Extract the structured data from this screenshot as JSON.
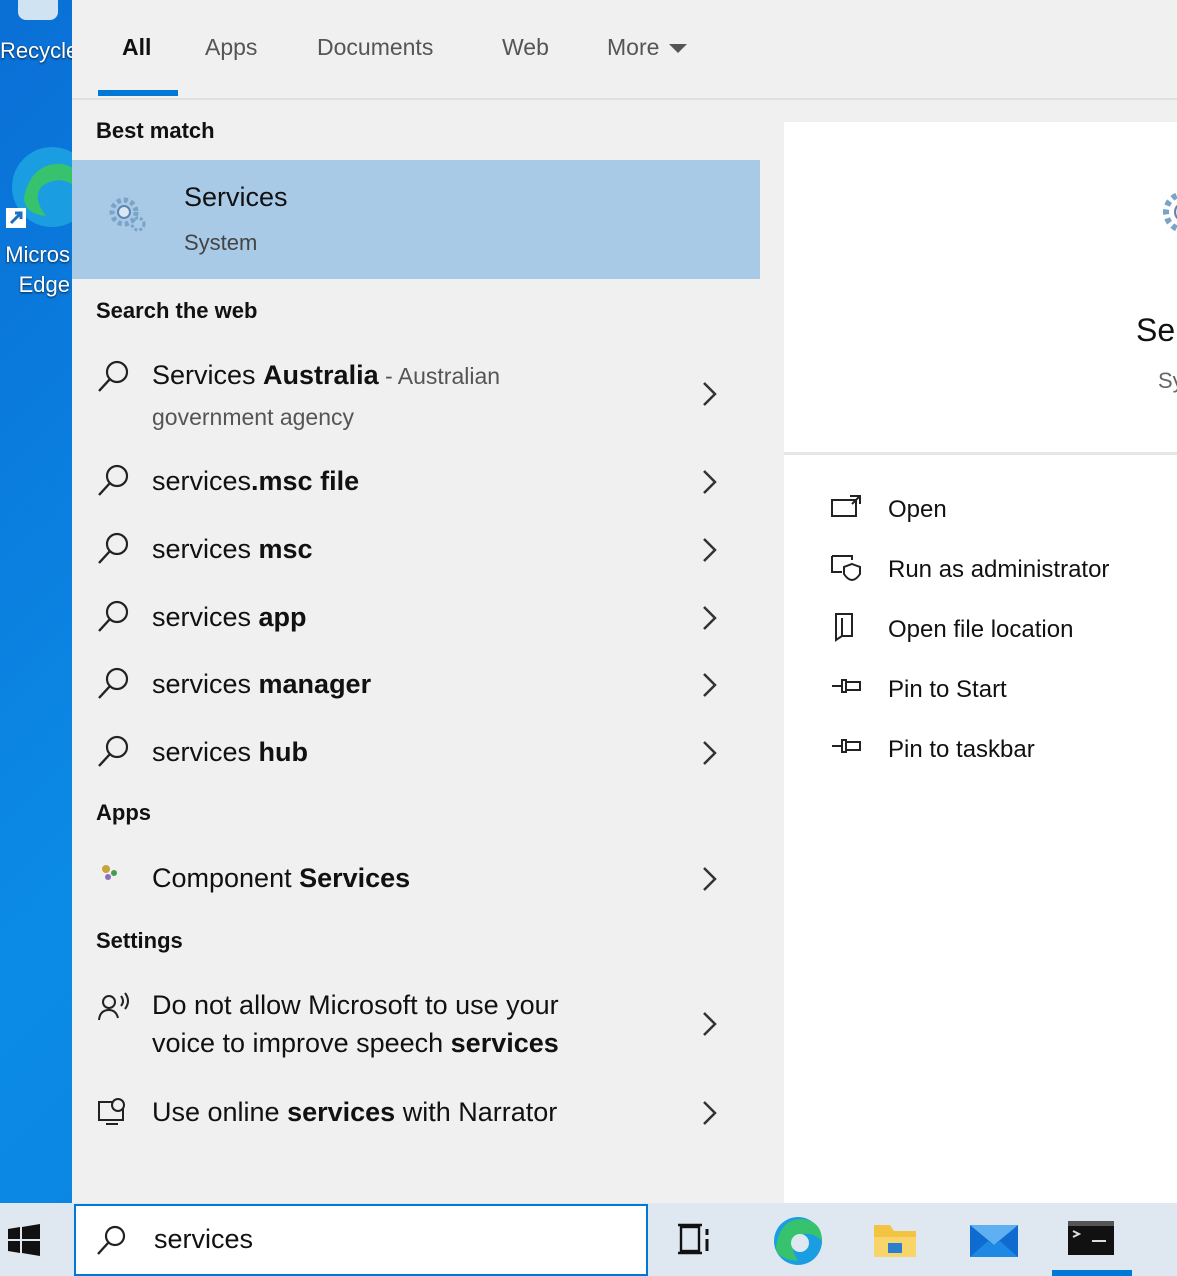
{
  "desktop": {
    "recycle_label": "Recycle",
    "edge_label_1": "Micros",
    "edge_label_2": "Edge"
  },
  "tabs": [
    {
      "label": "All"
    },
    {
      "label": "Apps"
    },
    {
      "label": "Documents"
    },
    {
      "label": "Web"
    },
    {
      "label": "More"
    }
  ],
  "best_match": {
    "heading": "Best match",
    "title": "Services",
    "subtitle": "System"
  },
  "web": {
    "heading": "Search the web",
    "items": [
      {
        "prefix": "Services ",
        "bold": "Australia",
        "desc": " - Australian",
        "line2": "government agency"
      },
      {
        "prefix": "services",
        "bold": ".msc file"
      },
      {
        "prefix": "services ",
        "bold": "msc"
      },
      {
        "prefix": "services ",
        "bold": "app"
      },
      {
        "prefix": "services ",
        "bold": "manager"
      },
      {
        "prefix": "services ",
        "bold": "hub"
      }
    ]
  },
  "apps": {
    "heading": "Apps",
    "items": [
      {
        "prefix": "Component ",
        "bold": "Services"
      }
    ]
  },
  "settings": {
    "heading": "Settings",
    "items": [
      {
        "line1": "Do not allow Microsoft to use your",
        "line2_prefix": "voice to improve speech ",
        "line2_bold": "services"
      },
      {
        "prefix": "Use online ",
        "bold": "services",
        "suffix": " with Narrator"
      }
    ]
  },
  "preview": {
    "title": "Ser",
    "subtitle": "Sy",
    "actions": [
      {
        "label": "Open",
        "icon": "open-icon"
      },
      {
        "label": "Run as administrator",
        "icon": "shield-icon"
      },
      {
        "label": "Open file location",
        "icon": "file-location-icon"
      },
      {
        "label": "Pin to Start",
        "icon": "pin-icon"
      },
      {
        "label": "Pin to taskbar",
        "icon": "pin-icon"
      }
    ]
  },
  "taskbar": {
    "search_value": "services"
  },
  "colors": {
    "accent": "#0078d7",
    "selected_row": "#a9cae7",
    "panel_bg": "#f0f0f0"
  }
}
